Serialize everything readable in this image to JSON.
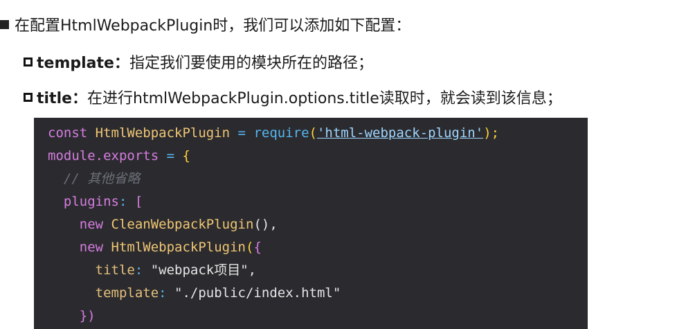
{
  "bullets": {
    "intro": "在配置HtmlWebpackPlugin时，我们可以添加如下配置：",
    "template_key": "template：",
    "template_desc": "指定我们要使用的模块所在的路径；",
    "title_key": "title：",
    "title_desc": "在进行htmlWebpackPlugin.options.title读取时，就会读到该信息；"
  },
  "code": {
    "l1_const": "const",
    "l1_name": " HtmlWebpackPlugin ",
    "l1_eq": "=",
    "l1_require": " require",
    "l1_open": "(",
    "l1_str": "'html-webpack-plugin'",
    "l1_close": ");",
    "l2_module": "module.exports",
    "l2_eq": " = ",
    "l2_brace": "{",
    "l3_comment": "// 其他省略",
    "l4_plugins": "plugins",
    "l4_colon": ": ",
    "l4_bracket": "[",
    "l5_new": "new",
    "l5_cls": " CleanWebpackPlugin",
    "l5_rest": "(),",
    "l6_new": "new",
    "l6_cls": " HtmlWebpackPlugin",
    "l6_paren": "(",
    "l6_brace": "{",
    "l7_key": "title",
    "l7_colon": ": ",
    "l7_val": "\"webpack项目\",",
    "l8_key": "template",
    "l8_colon": ": ",
    "l8_val": "\"./public/index.html\"",
    "l9_close": "})"
  },
  "colors": {
    "code_bg": "#2b2b2f",
    "keyword": "#d67de0",
    "class": "#f0c674",
    "function": "#56b6f0",
    "comment": "#6b6f78"
  }
}
